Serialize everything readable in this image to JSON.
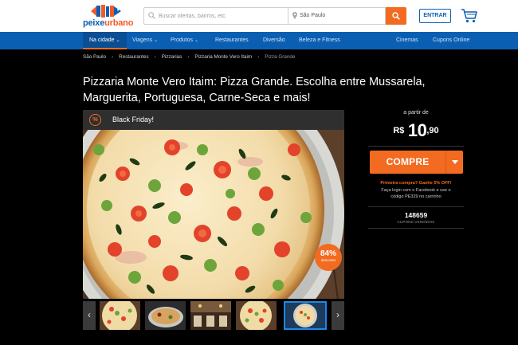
{
  "header": {
    "logo": {
      "part1": "peixe",
      "part2": "urbano"
    },
    "search": {
      "placeholder": "Buscar ofertas, bairros, etc.",
      "city": "São Paulo"
    },
    "login_label": "ENTRAR"
  },
  "nav": {
    "items": [
      {
        "label": "Na cidade"
      },
      {
        "label": "Viagens"
      },
      {
        "label": "Produtos"
      },
      {
        "label": "Restaurantes"
      },
      {
        "label": "Diversão"
      },
      {
        "label": "Beleza e Fitness"
      },
      {
        "label": "Cinemas"
      },
      {
        "label": "Cupons Online"
      }
    ]
  },
  "breadcrumb": [
    "São Paulo",
    "Restaurantes",
    "Pizzarias",
    "Pizzaria Monte Vero Itaim",
    "Pizza Grande"
  ],
  "title": "Pizzaria Monte Vero Itaim: Pizza Grande. Escolha entre Mussarela, Marguerita, Portuguesa, Carne-Seca e mais!",
  "deal": {
    "banner": "Black Friday!",
    "discount": "84%",
    "discount_label": "desconto"
  },
  "thumbnails": {
    "prev": "‹",
    "next": "›"
  },
  "sidebar": {
    "from_label": "a partir de",
    "currency": "R$",
    "price_int": "10",
    "price_dec": ",90",
    "buy_label": "COMPRE",
    "promo_title": "Primeira compra? Ganhe 5% OFF!",
    "promo_text": "Faça login com o Facebook e use o código PE329 no carrinho",
    "coupons_count": "148659",
    "coupons_label": "CUPONS VENDIDOS"
  },
  "colors": {
    "brand_blue": "#0b5fb3",
    "brand_orange": "#f26b21"
  }
}
